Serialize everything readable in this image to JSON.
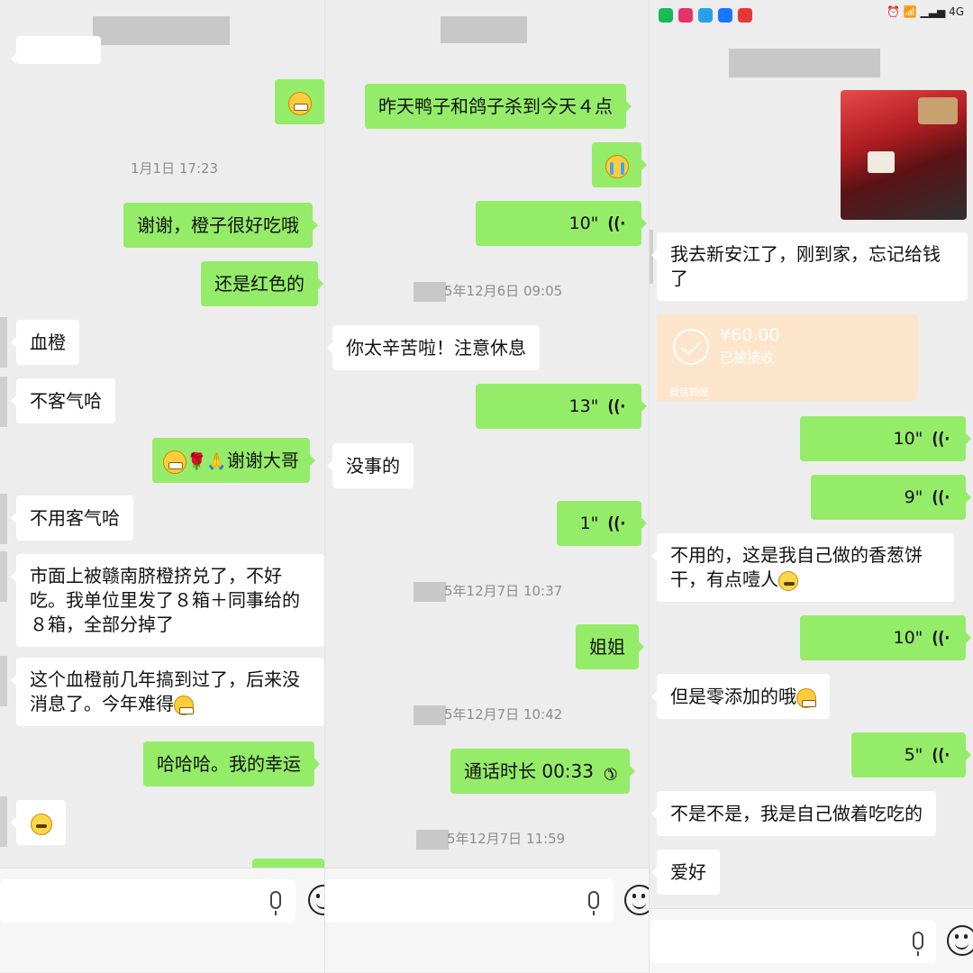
{
  "panel1": {
    "time_1": "1月1日 17:23",
    "msg_thanks_orange": "谢谢，橙子很好吃哦",
    "msg_red": "还是红色的",
    "msg_blood_orange": "血橙",
    "msg_welcome": "不客气哈",
    "msg_thanks_brother": "谢谢大哥",
    "msg_no_need": "不用客气哈",
    "msg_market": "市面上被赣南脐橙挤兑了，不好吃。我单位里发了８箱＋同事给的８箱，全部分掉了",
    "msg_rare": "这个血橙前几年搞到过了，后来没消息了。今年难得",
    "msg_lucky": "哈哈哈。我的幸运"
  },
  "panel2": {
    "msg_duck": "昨天鸭子和鸽子杀到今天４点",
    "voice_1": "10\"",
    "time_1": "5年12月6日 09:05",
    "msg_hard_work": "你太辛苦啦！注意休息",
    "voice_2": "13\"",
    "msg_fine": "没事的",
    "voice_3": "1\"",
    "time_2": "5年12月7日 10:37",
    "msg_sister": "姐姐",
    "time_3": "5年12月7日 10:42",
    "msg_call": "通话时长 00:33",
    "time_4": "5年12月7日 11:59"
  },
  "panel3": {
    "status_sim": "4G",
    "msg_xinanjiang": "我去新安江了，刚到家，忘记给钱了",
    "transfer_amount": "¥60.00",
    "transfer_status": "已被接收",
    "transfer_footer": "微信转账",
    "voice_1": "10\"",
    "voice_2": "9\"",
    "msg_scallion": "不用的，这是我自己做的香葱饼干，有点噎人",
    "voice_3": "10\"",
    "msg_zero_add": "但是零添加的哦",
    "voice_4": "5\"",
    "msg_self_made": "不是不是，我是自己做着吃吃的",
    "msg_hobby": "爱好"
  },
  "colors": {
    "sent_bubble": "#95ec69",
    "received_bubble": "#ffffff",
    "background": "#ededed",
    "transfer": "#fde5cc"
  },
  "icons": [
    "grin-emoji",
    "cry-emoji",
    "sweat-emoji",
    "rose-emoji",
    "pray-emoji",
    "voice-wave-icon",
    "call-end-icon",
    "mic-icon",
    "emoji-icon",
    "check-icon"
  ]
}
